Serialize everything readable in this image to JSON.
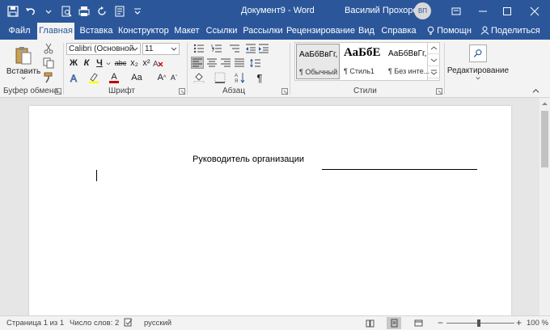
{
  "titlebar": {
    "doc_title": "Документ9  -  Word",
    "user_name": "Василий Прохоров",
    "avatar_initials": "ВП"
  },
  "tabs": [
    {
      "label": "Файл"
    },
    {
      "label": "Главная"
    },
    {
      "label": "Вставка"
    },
    {
      "label": "Конструктор"
    },
    {
      "label": "Макет"
    },
    {
      "label": "Ссылки"
    },
    {
      "label": "Рассылки"
    },
    {
      "label": "Рецензирование"
    },
    {
      "label": "Вид"
    },
    {
      "label": "Справка"
    },
    {
      "label": "Помощн"
    },
    {
      "label": "Поделиться"
    }
  ],
  "ribbon": {
    "clipboard": {
      "paste_label": "Вставить",
      "group_label": "Буфер обмена"
    },
    "font": {
      "font_name": "Calibri (Основной",
      "font_size": "11",
      "bold": "Ж",
      "italic": "К",
      "underline": "Ч",
      "strike": "abc",
      "subscript": "x₂",
      "superscript": "x²",
      "font_color": "A",
      "change_case": "Aa",
      "grow": "A",
      "shrink": "A",
      "group_label": "Шрифт"
    },
    "paragraph": {
      "pilcrow": "¶",
      "group_label": "Абзац"
    },
    "styles": {
      "items": [
        {
          "sample": "АаБбВвГг,",
          "name": "¶ Обычный"
        },
        {
          "sample": "АаБбЕ",
          "name": "¶ Стиль1"
        },
        {
          "sample": "АаБбВвГг,",
          "name": "¶ Без инте..."
        }
      ],
      "group_label": "Стили"
    },
    "editing": {
      "label": "Редактирование"
    }
  },
  "document": {
    "text": "Руководитель организации"
  },
  "status": {
    "page": "Страница 1 из 1",
    "words": "Число слов: 2",
    "language": "русский",
    "zoom": "100 %",
    "zoom_minus": "−",
    "zoom_plus": "+"
  },
  "colors": {
    "brand": "#2b579a",
    "ribbon_bg": "#f3f3f3",
    "font_color_bar": "#c00000",
    "highlight_bar": "#ffff00"
  }
}
